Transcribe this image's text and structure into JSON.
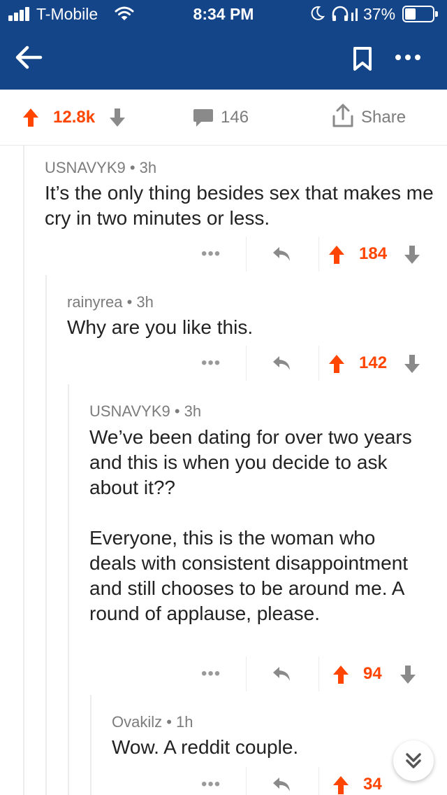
{
  "status_bar": {
    "carrier": "T-Mobile",
    "time": "8:34 PM",
    "battery": "37%"
  },
  "post_actions": {
    "score": "12.8k",
    "comments": "146",
    "share_label": "Share"
  },
  "comments": [
    {
      "author": "USNAVYK9",
      "age": "3h",
      "meta": "USNAVYK9 • 3h",
      "body": [
        "It’s the only thing besides sex that makes me cry in two minutes or less."
      ],
      "score": "184",
      "depth": 0
    },
    {
      "author": "rainyrea",
      "age": "3h",
      "meta": "rainyrea • 3h",
      "body": [
        "Why are you like this."
      ],
      "score": "142",
      "depth": 1
    },
    {
      "author": "USNAVYK9",
      "age": "3h",
      "meta": "USNAVYK9 • 3h",
      "body": [
        "We’ve been dating for over two years and this is when you decide to ask about it??",
        "Everyone, this is the woman who deals with consistent disappointment and still chooses to be around me. A round of applause, please."
      ],
      "score": "94",
      "depth": 2
    },
    {
      "author": "Ovakilz",
      "age": "1h",
      "meta": "Ovakilz • 1h",
      "body": [
        "Wow. A reddit couple."
      ],
      "score": "34",
      "depth": 3
    }
  ],
  "icons": {
    "nav": [
      "back-arrow-icon",
      "bookmark-icon",
      "more-icon"
    ],
    "actions": [
      "upvote-icon",
      "downvote-icon",
      "comment-icon",
      "share-icon",
      "reply-icon",
      "more-dots-icon",
      "chevron-down-icon"
    ]
  },
  "colors": {
    "header_bg": "#134588",
    "upvote_orange": "#ff4500",
    "muted_gray": "#7c7c7c",
    "text": "#222222"
  }
}
